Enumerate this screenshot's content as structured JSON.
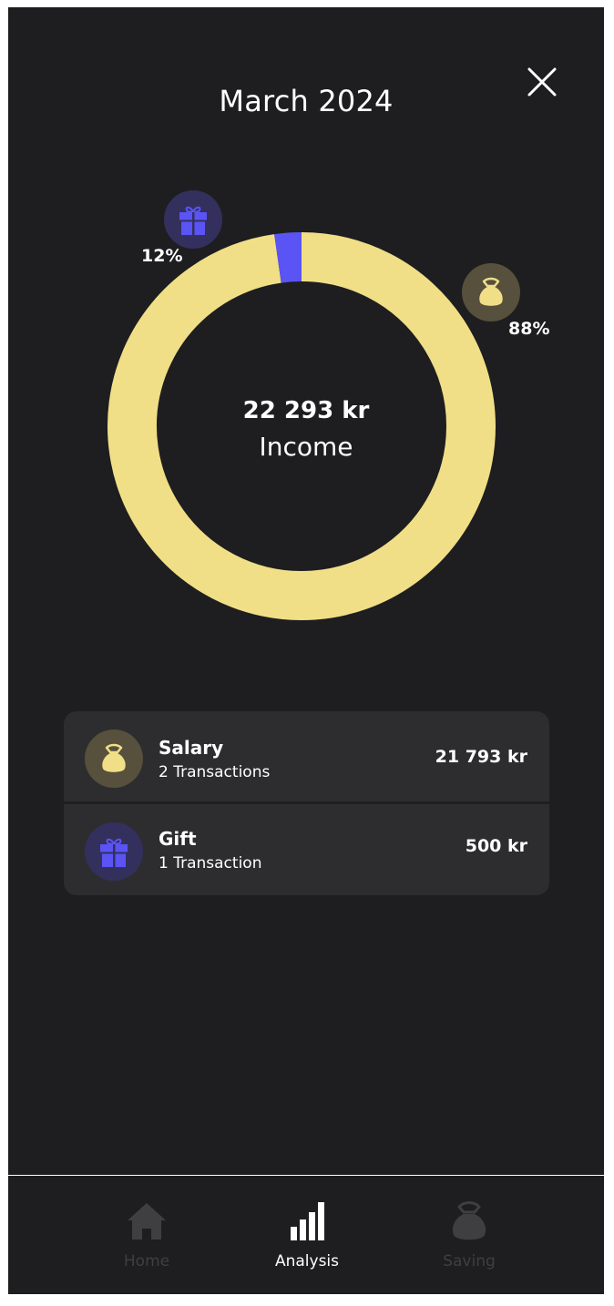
{
  "header": {
    "title": "March 2024",
    "close_icon": "close-icon"
  },
  "summary": {
    "amount": "22 293 kr",
    "label": "Income"
  },
  "chart_data": {
    "type": "pie",
    "categories": [
      "Salary",
      "Gift"
    ],
    "values": [
      21793,
      500
    ],
    "percent_labels": [
      "88%",
      "12%"
    ],
    "colors": [
      "#f0df87",
      "#5a54f4"
    ],
    "icons": [
      "money-bag-icon",
      "gift-icon"
    ]
  },
  "breakdown": [
    {
      "name": "Salary",
      "transactions": "2 Transactions",
      "amount": "21 793 kr",
      "icon": "money-bag-icon",
      "color": "#f0df87"
    },
    {
      "name": "Gift",
      "transactions": "1 Transaction",
      "amount": "500 kr",
      "icon": "gift-icon",
      "color": "#5a54f4"
    }
  ],
  "nav": {
    "items": [
      {
        "label": "Home",
        "icon": "home-icon",
        "active": false
      },
      {
        "label": "Analysis",
        "icon": "bar-chart-icon",
        "active": true
      },
      {
        "label": "Saving",
        "icon": "money-bag-icon",
        "active": false
      }
    ]
  },
  "colors": {
    "background": "#1e1e20",
    "salary_yellow": "#f0df87",
    "gift_blue": "#5a54f4",
    "card": "#2d2d30",
    "nav_inactive": "#3f3f42"
  }
}
